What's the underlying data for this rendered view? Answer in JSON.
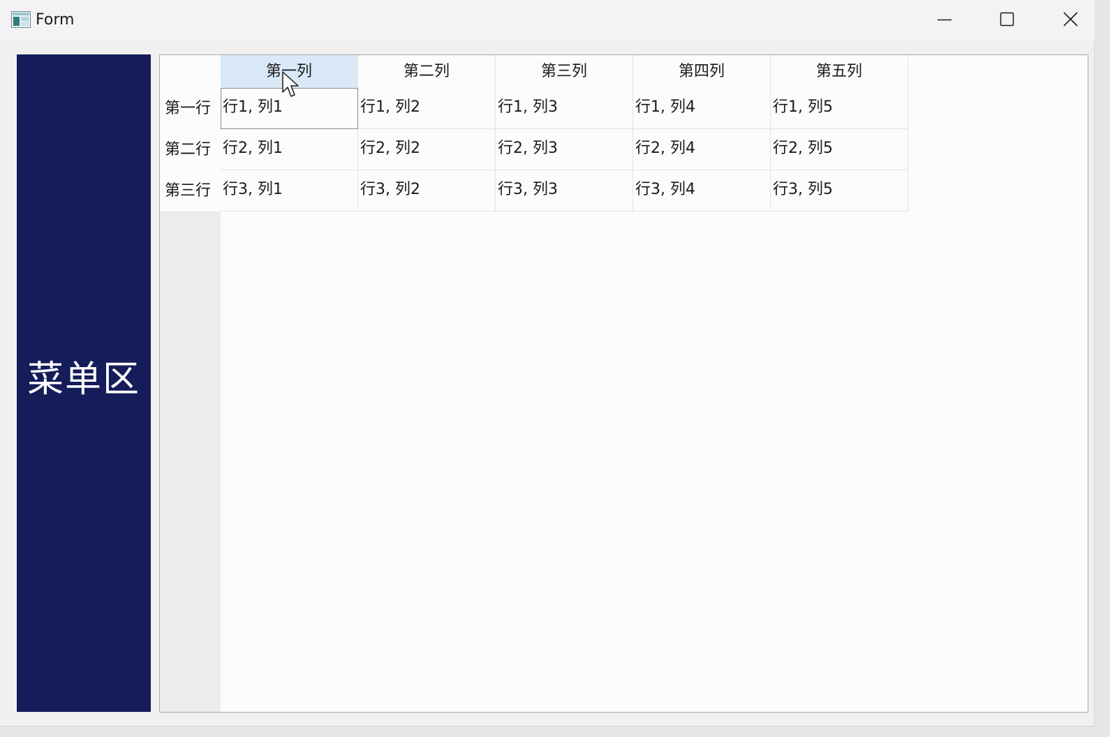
{
  "window": {
    "title": "Form",
    "icon": "app-form-icon",
    "controls": [
      "minimize-icon",
      "maximize-icon",
      "close-icon"
    ]
  },
  "menu": {
    "label": "菜单区",
    "background": "#141c5a"
  },
  "table": {
    "columns": [
      "第一列",
      "第二列",
      "第三列",
      "第四列",
      "第五列"
    ],
    "rows": [
      {
        "header": "第一行",
        "cells": [
          "行1, 列1",
          "行1, 列2",
          "行1, 列3",
          "行1, 列4",
          "行1, 列5"
        ]
      },
      {
        "header": "第二行",
        "cells": [
          "行2, 列1",
          "行2, 列2",
          "行2, 列3",
          "行2, 列4",
          "行2, 列5"
        ]
      },
      {
        "header": "第三行",
        "cells": [
          "行3, 列1",
          "行3, 列2",
          "行3, 列3",
          "行3, 列4",
          "行3, 列5"
        ]
      }
    ],
    "selected_column": "第一列",
    "current_cell": "行1, 列1",
    "selection_color": "#d9e9f8"
  }
}
